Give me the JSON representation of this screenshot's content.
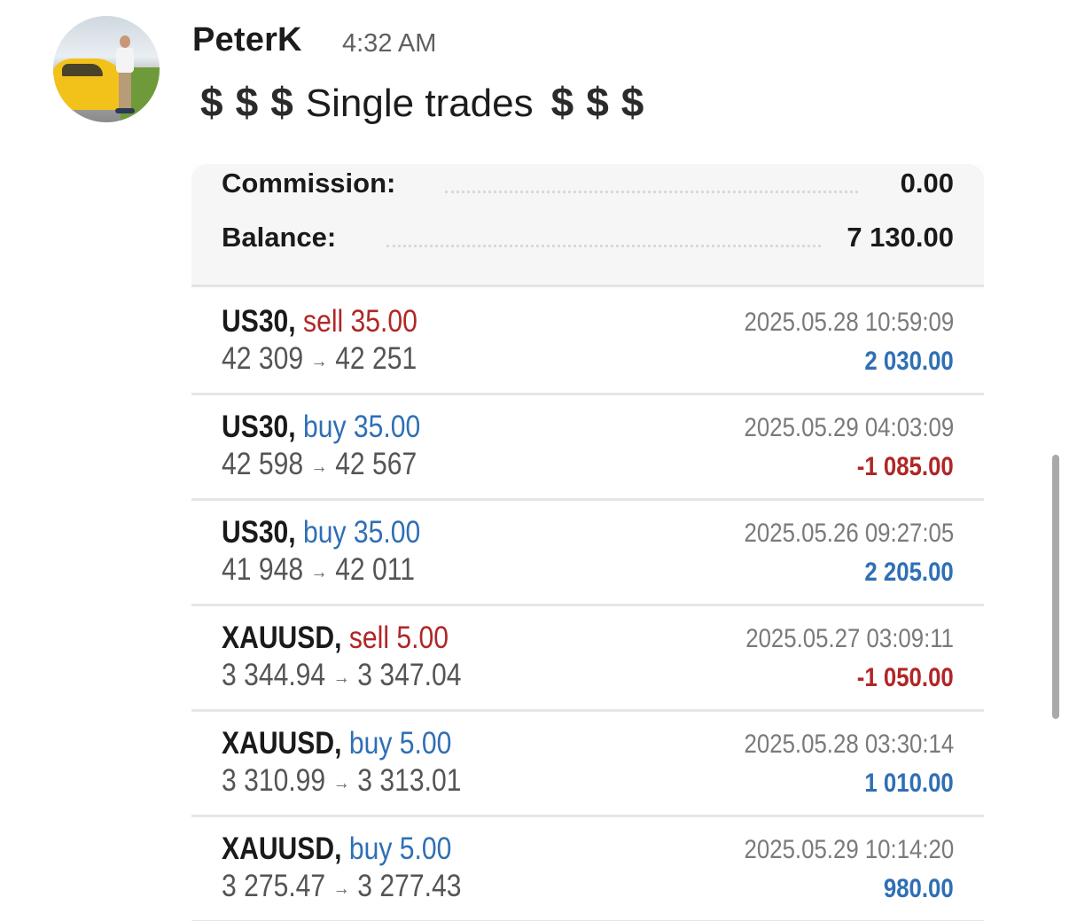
{
  "message": {
    "author": "PeterK",
    "time": "4:32 AM",
    "text_left_icons": [
      "$",
      "$",
      "$"
    ],
    "text": "Single trades",
    "text_right_icons": [
      "$",
      "$",
      "$"
    ]
  },
  "summary": {
    "commission_label": "Commission:",
    "commission_value": "0.00",
    "balance_label": "Balance:",
    "balance_value": "7 130.00"
  },
  "trades": [
    {
      "symbol": "US30,",
      "side": "sell 35.00",
      "side_type": "sell",
      "open": "42 309",
      "arrow": "→",
      "close": "42 251",
      "datetime": "2025.05.28 10:59:09",
      "profit": "2 030.00",
      "profit_sign": "pos"
    },
    {
      "symbol": "US30,",
      "side": "buy 35.00",
      "side_type": "buy",
      "open": "42 598",
      "arrow": "→",
      "close": "42 567",
      "datetime": "2025.05.29 04:03:09",
      "profit": "-1 085.00",
      "profit_sign": "neg"
    },
    {
      "symbol": "US30,",
      "side": "buy 35.00",
      "side_type": "buy",
      "open": "41 948",
      "arrow": "→",
      "close": "42 011",
      "datetime": "2025.05.26 09:27:05",
      "profit": "2 205.00",
      "profit_sign": "pos"
    },
    {
      "symbol": "XAUUSD,",
      "side": "sell 5.00",
      "side_type": "sell",
      "open": "3 344.94",
      "arrow": "→",
      "close": "3 347.04",
      "datetime": "2025.05.27 03:09:11",
      "profit": "-1 050.00",
      "profit_sign": "neg"
    },
    {
      "symbol": "XAUUSD,",
      "side": "buy 5.00",
      "side_type": "buy",
      "open": "3 310.99",
      "arrow": "→",
      "close": "3 313.01",
      "datetime": "2025.05.28 03:30:14",
      "profit": "1 010.00",
      "profit_sign": "pos"
    },
    {
      "symbol": "XAUUSD,",
      "side": "buy 5.00",
      "side_type": "buy",
      "open": "3 275.47",
      "arrow": "→",
      "close": "3 277.43",
      "datetime": "2025.05.29 10:14:20",
      "profit": "980.00",
      "profit_sign": "pos"
    }
  ],
  "colors": {
    "sell": "#b12626",
    "buy": "#2f6fb5",
    "profit_positive": "#2f6fb5",
    "profit_negative": "#b12626"
  }
}
